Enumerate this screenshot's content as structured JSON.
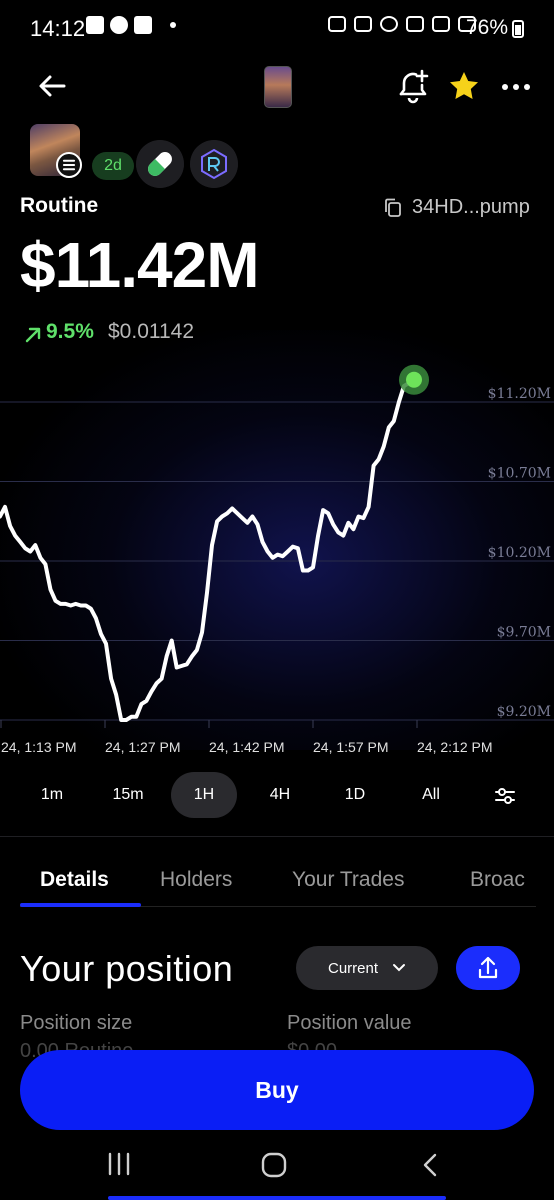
{
  "status_bar": {
    "time": "14:12",
    "battery": "76%"
  },
  "header": {
    "icons": [
      "back-arrow-icon",
      "bell-plus-icon",
      "star-icon",
      "more-icon"
    ],
    "star_color": "#f6d21a"
  },
  "token": {
    "age": "2d",
    "name": "Routine",
    "contract": "34HD...pump",
    "market_cap": "$11.42M",
    "change": "9.5%",
    "price": "$0.01142",
    "change_color": "#5fe06a"
  },
  "chart_data": {
    "type": "line",
    "y_ticks": [
      "$11.20M",
      "$10.70M",
      "$10.20M",
      "$9.70M",
      "$9.20M"
    ],
    "x_ticks": [
      "24, 1:13 PM",
      "24, 1:27 PM",
      "24, 1:42 PM",
      "24, 1:57 PM",
      "24, 2:12 PM"
    ],
    "ylim": [
      9.2,
      11.2
    ],
    "grid": true,
    "y": [
      10.48,
      10.54,
      10.42,
      10.36,
      10.32,
      10.28,
      10.26,
      10.3,
      10.22,
      10.18,
      10.02,
      9.95,
      9.93,
      9.93,
      9.92,
      9.93,
      9.92,
      9.92,
      9.9,
      9.84,
      9.74,
      9.68,
      9.46,
      9.36,
      9.2,
      9.2,
      9.22,
      9.22,
      9.3,
      9.32,
      9.38,
      9.43,
      9.46,
      9.6,
      9.7,
      9.53,
      9.54,
      9.55,
      9.6,
      9.64,
      9.75,
      10.0,
      10.3,
      10.45,
      10.48,
      10.5,
      10.53,
      10.5,
      10.47,
      10.44,
      10.48,
      10.43,
      10.32,
      10.26,
      10.22,
      10.24,
      10.23,
      10.26,
      10.29,
      10.28,
      10.14,
      10.14,
      10.16,
      10.36,
      10.52,
      10.5,
      10.43,
      10.38,
      10.36,
      10.44,
      10.4,
      10.48,
      10.47,
      10.54,
      10.8,
      10.84,
      10.92,
      11.04,
      11.08,
      11.2,
      11.3,
      11.32,
      11.34
    ]
  },
  "timeframes": {
    "items": [
      "1m",
      "15m",
      "1H",
      "4H",
      "1D",
      "All"
    ],
    "active": "1H"
  },
  "tabs": [
    "Details",
    "Holders",
    "Your Trades",
    "Broac"
  ],
  "position": {
    "title": "Your position",
    "dropdown": "Current",
    "size_label": "Position size",
    "value_label": "Position value",
    "size_value": "0.00 Routine",
    "value_value": "$0.00"
  },
  "buy_label": "Buy",
  "colors": {
    "accent": "#1b2dfc",
    "buy": "#0a1ef5",
    "positive": "#5fe06a",
    "background": "#000000"
  }
}
